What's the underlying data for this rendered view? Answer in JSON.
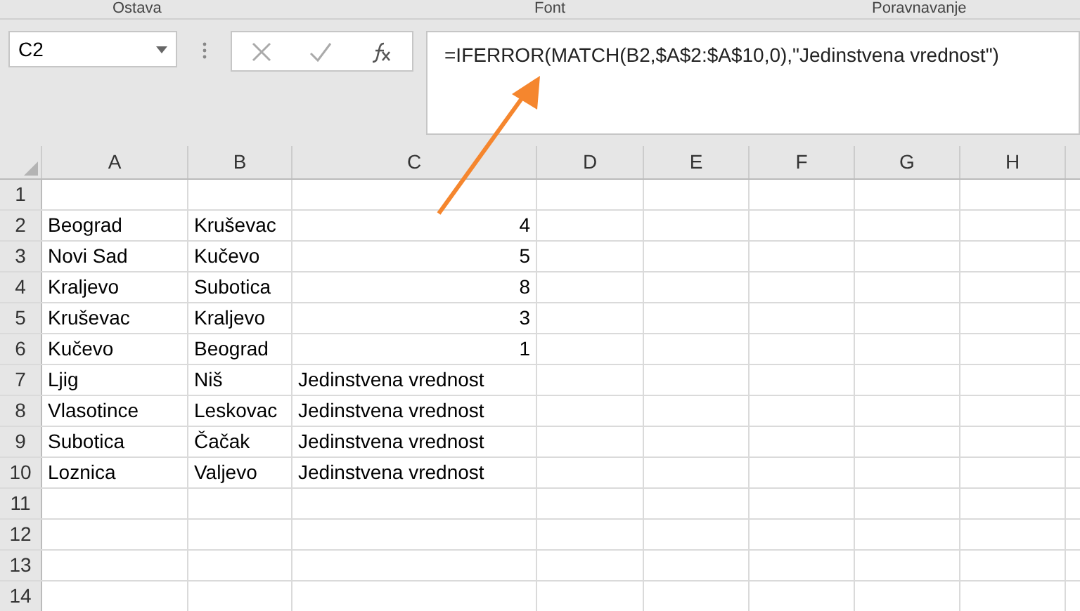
{
  "ribbon_groups": [
    "Ostava",
    "Font",
    "Poravnavanje"
  ],
  "name_box": {
    "value": "C2"
  },
  "formula_bar": {
    "value": "=IFERROR(MATCH(B2,$A$2:$A$10,0),\"Jedinstvena vrednost\")"
  },
  "columns": [
    "A",
    "B",
    "C",
    "D",
    "E",
    "F",
    "G",
    "H"
  ],
  "rows": [
    {
      "number": "1",
      "cells": []
    },
    {
      "number": "2",
      "cells": [
        "Beograd",
        "Kruševac",
        "4"
      ]
    },
    {
      "number": "3",
      "cells": [
        "Novi Sad",
        "Kučevo",
        "5"
      ]
    },
    {
      "number": "4",
      "cells": [
        "Kraljevo",
        "Subotica",
        "8"
      ]
    },
    {
      "number": "5",
      "cells": [
        "Kruševac",
        "Kraljevo",
        "3"
      ]
    },
    {
      "number": "6",
      "cells": [
        "Kučevo",
        "Beograd",
        "1"
      ]
    },
    {
      "number": "7",
      "cells": [
        "Ljig",
        "Niš",
        "Jedinstvena vrednost"
      ]
    },
    {
      "number": "8",
      "cells": [
        "Vlasotince",
        "Leskovac",
        "Jedinstvena vrednost"
      ]
    },
    {
      "number": "9",
      "cells": [
        "Subotica",
        "Čačak",
        "Jedinstvena vrednost"
      ]
    },
    {
      "number": "10",
      "cells": [
        "Loznica",
        "Valjevo",
        "Jedinstvena vrednost"
      ]
    },
    {
      "number": "11",
      "cells": []
    },
    {
      "number": "12",
      "cells": []
    },
    {
      "number": "13",
      "cells": []
    },
    {
      "number": "14",
      "cells": []
    }
  ]
}
